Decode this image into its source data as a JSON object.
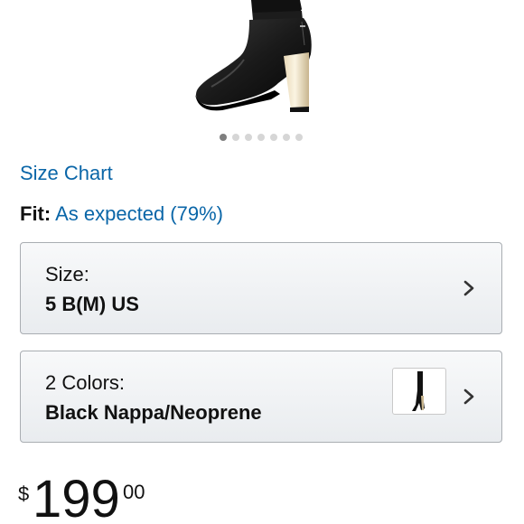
{
  "product": {
    "image_alt": "black over-the-knee heeled boot",
    "carousel": {
      "total": 7,
      "active_index": 0
    }
  },
  "size_chart_label": "Size Chart",
  "fit": {
    "label": "Fit:",
    "value": "As expected (79%)"
  },
  "size_selector": {
    "label": "Size:",
    "value": "5 B(M) US",
    "icon": "chevron-right-icon"
  },
  "color_selector": {
    "label": "2 Colors:",
    "value": "Black Nappa/Neoprene",
    "icon": "chevron-right-icon"
  },
  "price": {
    "symbol": "$",
    "whole": "199",
    "fraction": "00"
  },
  "colors": {
    "link": "#0a66a8",
    "text": "#111111",
    "border": "#a9adb2"
  }
}
